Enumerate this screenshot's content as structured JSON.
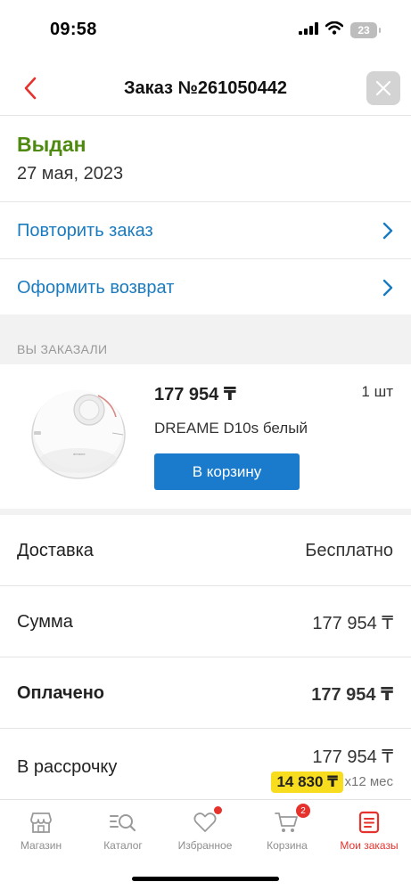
{
  "status_bar": {
    "time": "09:58",
    "battery": "23",
    "icons": [
      "signal-icon",
      "wifi-icon",
      "battery-icon"
    ]
  },
  "header": {
    "title": "Заказ №261050442",
    "back_icon": "chevron-left-icon",
    "close_icon": "close-icon"
  },
  "order": {
    "status": "Выдан",
    "date": "27 мая, 2023"
  },
  "actions": [
    {
      "label": "Повторить заказ"
    },
    {
      "label": "Оформить возврат"
    }
  ],
  "ordered_section": {
    "label": "ВЫ ЗАКАЗАЛИ"
  },
  "product": {
    "price": "177 954 ₸",
    "quantity": "1 шт",
    "name": "DREAME D10s белый",
    "cart_button": "В корзину",
    "image_label": "dreame"
  },
  "summary": {
    "delivery_label": "Доставка",
    "delivery_value": "Бесплатно",
    "sum_label": "Сумма",
    "sum_value": "177 954 ₸",
    "paid_label": "Оплачено",
    "paid_value": "177 954 ₸",
    "installment_label": "В рассрочку",
    "installment_value": "177 954 ₸",
    "installment_monthly": "14 830 ₸",
    "installment_months": "x12 мес"
  },
  "tab_bar": {
    "tabs": [
      {
        "label": "Магазин",
        "icon": "store-icon"
      },
      {
        "label": "Каталог",
        "icon": "catalog-search-icon"
      },
      {
        "label": "Избранное",
        "icon": "heart-icon"
      },
      {
        "label": "Корзина",
        "icon": "cart-icon",
        "badge": "2"
      },
      {
        "label": "Мои заказы",
        "icon": "orders-icon",
        "active": true
      }
    ]
  },
  "colors": {
    "accent_blue": "#1a7bcd",
    "link_blue": "#1a7bbf",
    "status_green": "#4f8a10",
    "active_red": "#e5322d",
    "installment_yellow": "#f8dc1e"
  }
}
